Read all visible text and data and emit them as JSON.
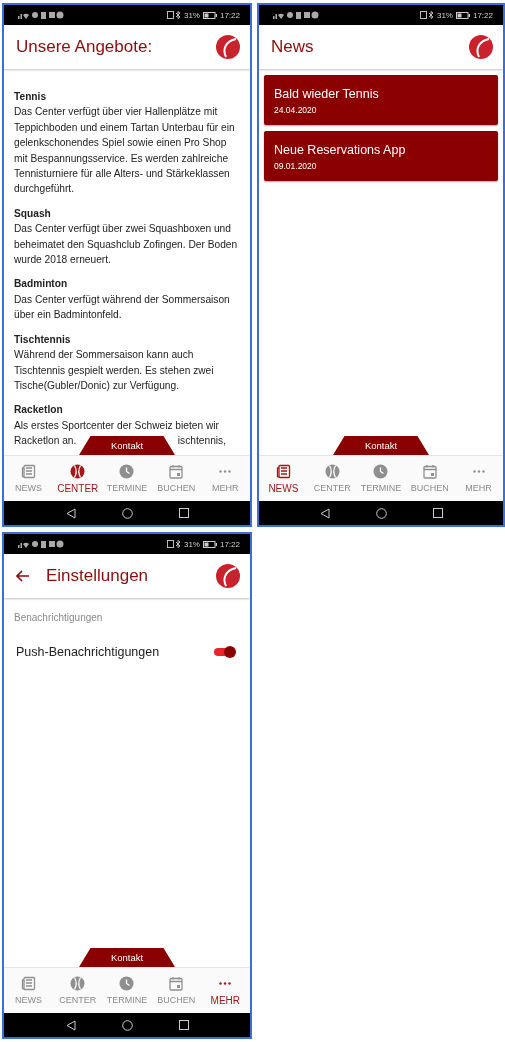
{
  "screens": [
    {
      "kind": "offers",
      "status": {
        "battery": "31%",
        "time": "17:22"
      },
      "title": "Unsere Angebote:",
      "sections": [
        {
          "heading": "Tennis",
          "text": "Das Center verfügt über vier Hallenplätze mit Teppichboden und einem Tartan Unterbau für ein gelenkschonendes Spiel sowie einen Pro Shop mit Bespannungsservice. Es werden zahlreiche Tennisturniere für alle Alters- und Stärkeklassen durchgeführt."
        },
        {
          "heading": "Squash",
          "text": "Das Center verfügt über zwei Squashboxen und beheimatet den Squashclub Zofingen. Der Boden wurde 2018 erneuert."
        },
        {
          "heading": "Badminton",
          "text": "Das Center verfügt während der Sommersaison über ein Badmintonfeld."
        },
        {
          "heading": "Tischtennis",
          "text": "Während der Sommersaison kann auch Tischtennis gespielt werden. Es stehen zwei Tische(Gubler/Donic) zur Verfügung."
        },
        {
          "heading": "Racketlon",
          "text": "Als erstes Sportcenter der Schweiz bieten wir",
          "fragments": [
            "Racketlon an.",
            "ischtennis,"
          ]
        }
      ],
      "kontakt": "Kontakt",
      "nav": [
        {
          "label": "NEWS",
          "selected": false
        },
        {
          "label": "CENTER",
          "selected": true
        },
        {
          "label": "TERMINE",
          "selected": false
        },
        {
          "label": "BUCHEN",
          "selected": false
        },
        {
          "label": "MEHR",
          "selected": false
        }
      ]
    },
    {
      "kind": "news",
      "status": {
        "battery": "31%",
        "time": "17:22"
      },
      "title": "News",
      "cards": [
        {
          "title": "Bald wieder Tennis",
          "date": "24.04.2020"
        },
        {
          "title": "Neue Reservations App",
          "date": "09.01.2020"
        }
      ],
      "kontakt": "Kontakt",
      "nav": [
        {
          "label": "NEWS",
          "selected": true
        },
        {
          "label": "CENTER",
          "selected": false
        },
        {
          "label": "TERMINE",
          "selected": false
        },
        {
          "label": "BUCHEN",
          "selected": false
        },
        {
          "label": "MEHR",
          "selected": false
        }
      ]
    },
    {
      "kind": "settings",
      "status": {
        "battery": "31%",
        "time": "17:22"
      },
      "title": "Einstellungen",
      "back": true,
      "group": "Benachrichtigungen",
      "settings": [
        {
          "label": "Push-Benachrichtigungen",
          "on": true
        }
      ],
      "kontakt": "Kontakt",
      "nav": [
        {
          "label": "NEWS",
          "selected": false
        },
        {
          "label": "CENTER",
          "selected": false
        },
        {
          "label": "TERMINE",
          "selected": false
        },
        {
          "label": "BUCHEN",
          "selected": false
        },
        {
          "label": "MEHR",
          "selected": true
        }
      ]
    }
  ]
}
